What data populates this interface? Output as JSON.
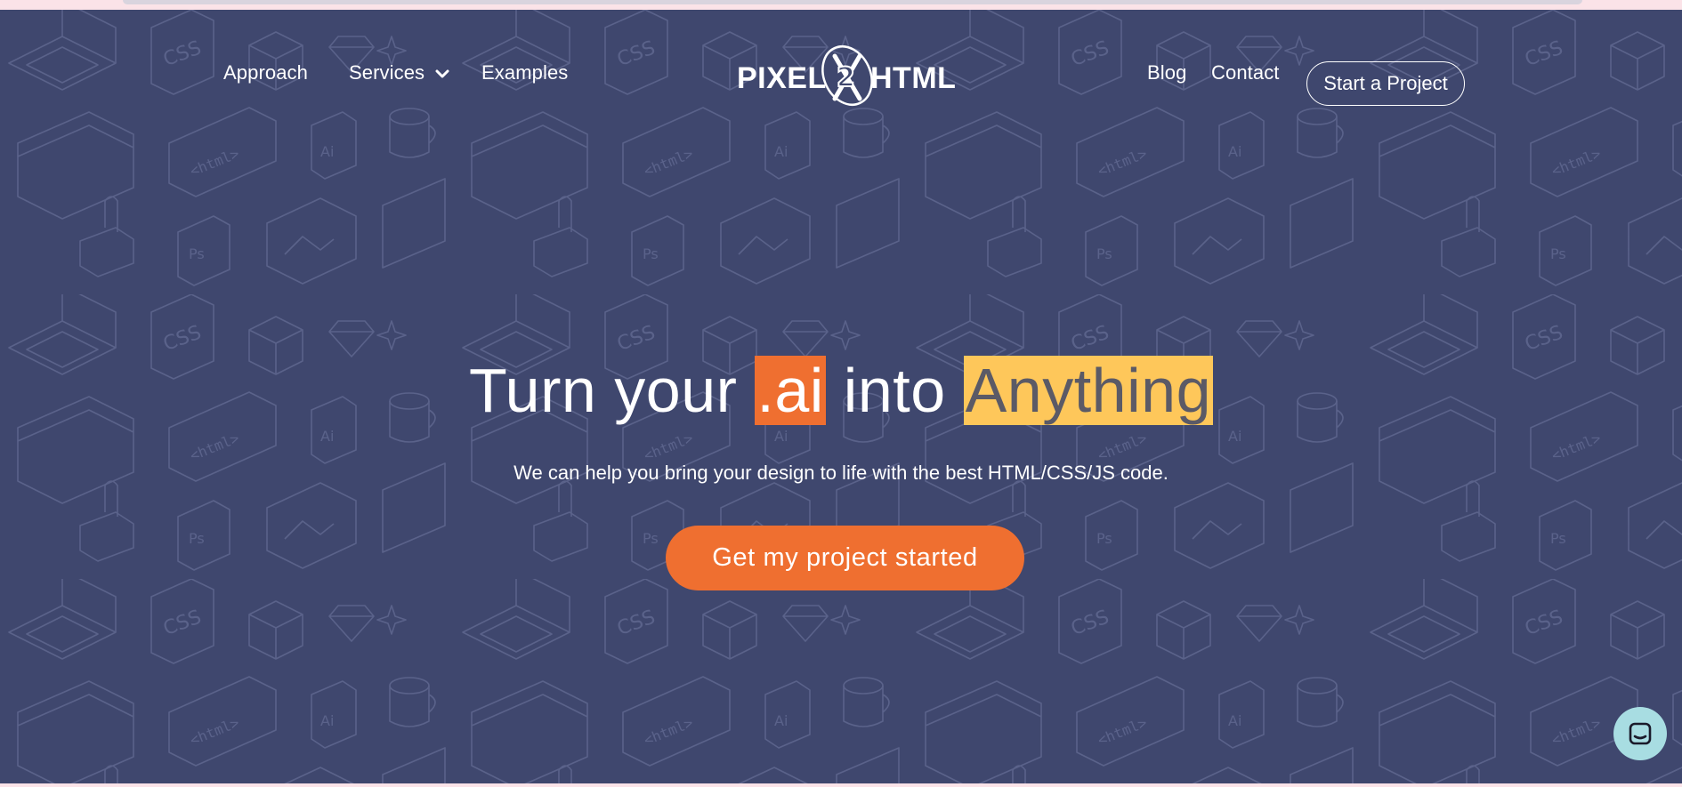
{
  "nav": {
    "left": [
      {
        "label": "Approach"
      },
      {
        "label": "Services"
      },
      {
        "label": "Examples"
      }
    ],
    "right": [
      {
        "label": "Blog"
      },
      {
        "label": "Contact"
      }
    ],
    "cta": "Start a Project"
  },
  "logo": {
    "left_text": "PIXEL",
    "right_text": "HTML",
    "icon": "pencil-brush-2-emblem-icon"
  },
  "hero": {
    "headline_prefix": "Turn your ",
    "headline_highlight_1": ".ai",
    "headline_middle": " into ",
    "headline_highlight_2": "Anything",
    "subheadline": "We can help you bring your design to life with the best HTML/CSS/JS code.",
    "cta": "Get my project started"
  },
  "chat": {
    "icon": "chat-icon"
  },
  "colors": {
    "hero_bg": "#3f476e",
    "accent_orange": "#ef6f30",
    "accent_yellow": "#fec75a",
    "chat_bg": "#a8dde2",
    "page_pink": "#fbe3e8"
  },
  "pattern_icons": [
    "css-file-icon",
    "html-tag-icon",
    "ai-file-icon",
    "ps-file-icon",
    "laptop-icon",
    "mug-icon",
    "gem-icon",
    "cube-icon",
    "cactus-icon",
    "image-icon",
    "sparkle-icon"
  ]
}
